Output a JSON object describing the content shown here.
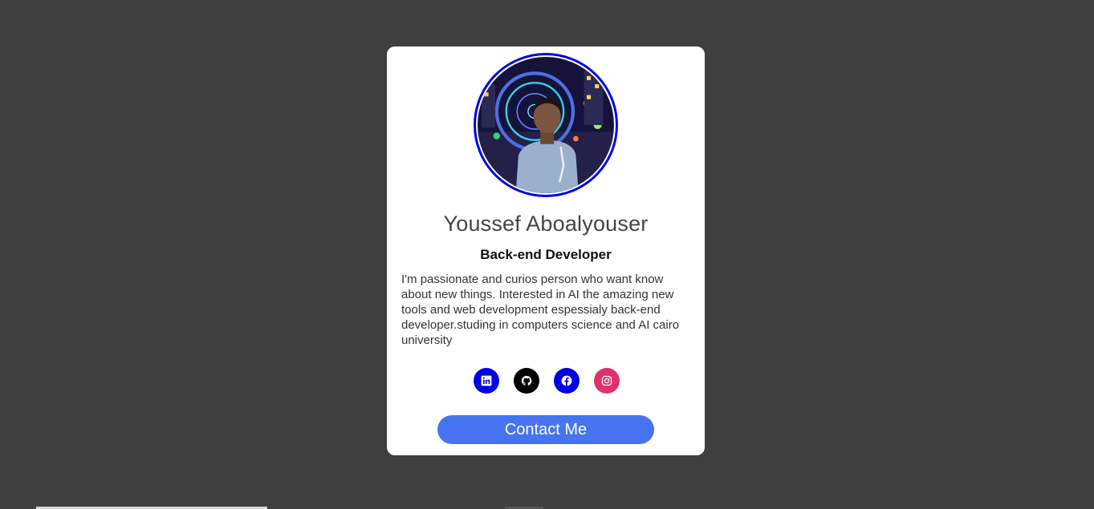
{
  "profile": {
    "name": "Youssef Aboalyouser",
    "role": "Back-end Developer",
    "bio": "I'm passionate and curios person who want know about new things. Interested in AI the amazing new tools and web development espessialy back-end developer.studing in computers science and AI cairo university",
    "avatar_icon": "profile-photo"
  },
  "socials": [
    {
      "name": "LinkedIn",
      "icon": "linkedin-icon",
      "color": "#0000e6"
    },
    {
      "name": "GitHub",
      "icon": "github-icon",
      "color": "#000000"
    },
    {
      "name": "Facebook",
      "icon": "facebook-icon",
      "color": "#0000e6"
    },
    {
      "name": "Instagram",
      "icon": "instagram-icon",
      "color": "#e1306c"
    }
  ],
  "contact": {
    "label": "Contact Me"
  },
  "colors": {
    "page_background": "#3f3f3f",
    "card_background": "#ffffff",
    "avatar_border": "#0000e6",
    "button": "#4674f0"
  }
}
